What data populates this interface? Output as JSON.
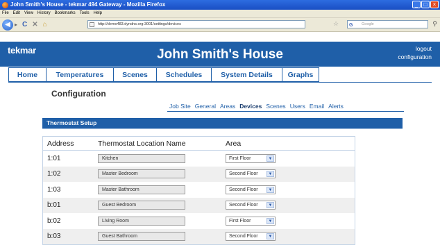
{
  "window": {
    "title": "John Smith's House - tekmar 494 Gateway - Mozilla Firefox"
  },
  "menu": [
    "File",
    "Edit",
    "View",
    "History",
    "Bookmarks",
    "Tools",
    "Help"
  ],
  "toolbar": {
    "url": "http://demo483.dyndns.org:3001/settings/devices",
    "search_placeholder": "Google"
  },
  "header": {
    "logo": "tekmar",
    "title": "John Smith's House",
    "logout": "logout",
    "configuration": "configuration",
    "color": "#1f5fa8"
  },
  "tabs": [
    {
      "label": "Home"
    },
    {
      "label": "Temperatures"
    },
    {
      "label": "Scenes"
    },
    {
      "label": "Schedules"
    },
    {
      "label": "System Details"
    },
    {
      "label": "Graphs"
    }
  ],
  "page": {
    "title": "Configuration",
    "subnav": [
      "Job Site",
      "General",
      "Areas",
      "Devices",
      "Scenes",
      "Users",
      "Email",
      "Alerts"
    ],
    "active_subnav": "Devices"
  },
  "thermostat_setup": {
    "heading": "Thermostat Setup",
    "columns": [
      "Address",
      "Thermostat Location Name",
      "Area"
    ],
    "rows": [
      {
        "address": "1:01",
        "name": "Kitchen",
        "area": "First Floor"
      },
      {
        "address": "1:02",
        "name": "Master Bedroom",
        "area": "Second Floor"
      },
      {
        "address": "1:03",
        "name": "Master Bathroom",
        "area": "Second Floor"
      },
      {
        "address": "b:01",
        "name": "Guest Bedroom",
        "area": "Second Floor"
      },
      {
        "address": "b:02",
        "name": "Living Room",
        "area": "First Floor"
      },
      {
        "address": "b:03",
        "name": "Guest Bathroom",
        "area": "Second Floor"
      }
    ]
  }
}
